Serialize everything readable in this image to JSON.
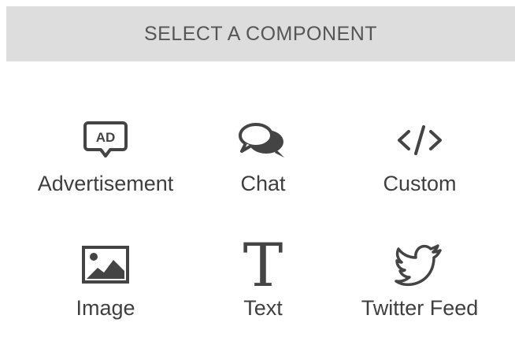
{
  "header": {
    "title": "SELECT A COMPONENT"
  },
  "components": [
    {
      "label": "Advertisement",
      "icon": "ad-icon",
      "badge_text": "AD"
    },
    {
      "label": "Chat",
      "icon": "chat-bubbles-icon"
    },
    {
      "label": "Custom",
      "icon": "code-icon"
    },
    {
      "label": "Image",
      "icon": "image-icon"
    },
    {
      "label": "Text",
      "icon": "text-icon",
      "glyph": "T"
    },
    {
      "label": "Twitter Feed",
      "icon": "twitter-bird-icon"
    }
  ],
  "colors": {
    "header_bg": "#dddddd",
    "icon": "#444444",
    "text": "#3f3f3f"
  }
}
